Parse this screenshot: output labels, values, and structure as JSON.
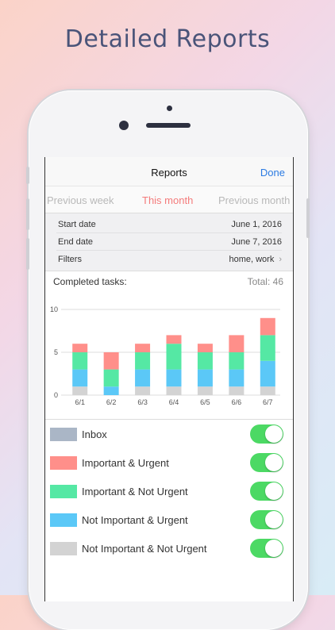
{
  "headline": "Detailed Reports",
  "navbar": {
    "title": "Reports",
    "done_label": "Done"
  },
  "period": {
    "previous": "Previous week",
    "current": "This month",
    "next": "Previous month"
  },
  "info_rows": [
    {
      "label": "Start date",
      "value": "June 1, 2016"
    },
    {
      "label": "End date",
      "value": "June 7, 2016"
    },
    {
      "label": "Filters",
      "value": "home, work"
    }
  ],
  "summary": {
    "completed_label": "Completed tasks:",
    "total_label": "Total: 46"
  },
  "colors": {
    "inbox": "#d3d3d3",
    "important_urgent": "#ff8f8a",
    "important_not_urgent": "#55e8a4",
    "not_important_urgent": "#5bc8f7",
    "not_important_not_urgent": "#d3d3d3",
    "inbox_swatch": "#aab6c6",
    "toggle_on": "#4cd964"
  },
  "chart_data": {
    "type": "bar",
    "stacked": true,
    "categories": [
      "6/1",
      "6/2",
      "6/3",
      "6/4",
      "6/5",
      "6/6",
      "6/7"
    ],
    "ylim": [
      0,
      10
    ],
    "yticks": [
      0,
      5,
      10
    ],
    "grid": true,
    "series": [
      {
        "name": "Not Important & Not Urgent",
        "values": [
          1,
          0,
          1,
          1,
          1,
          1,
          1
        ]
      },
      {
        "name": "Not Important & Urgent",
        "values": [
          2,
          1,
          2,
          2,
          2,
          2,
          3
        ]
      },
      {
        "name": "Important & Not Urgent",
        "values": [
          2,
          2,
          2,
          3,
          2,
          2,
          3
        ]
      },
      {
        "name": "Important & Urgent",
        "values": [
          1,
          2,
          1,
          1,
          1,
          2,
          2
        ]
      }
    ]
  },
  "legend": [
    {
      "label": "Inbox",
      "color_key": "inbox_swatch",
      "enabled": true
    },
    {
      "label": "Important & Urgent",
      "color_key": "important_urgent",
      "enabled": true
    },
    {
      "label": "Important & Not Urgent",
      "color_key": "important_not_urgent",
      "enabled": true
    },
    {
      "label": "Not Important & Urgent",
      "color_key": "not_important_urgent",
      "enabled": true
    },
    {
      "label": "Not Important & Not Urgent",
      "color_key": "not_important_not_urgent",
      "enabled": true
    }
  ],
  "icons": {
    "filters_chevron": "chevron-right-icon"
  }
}
